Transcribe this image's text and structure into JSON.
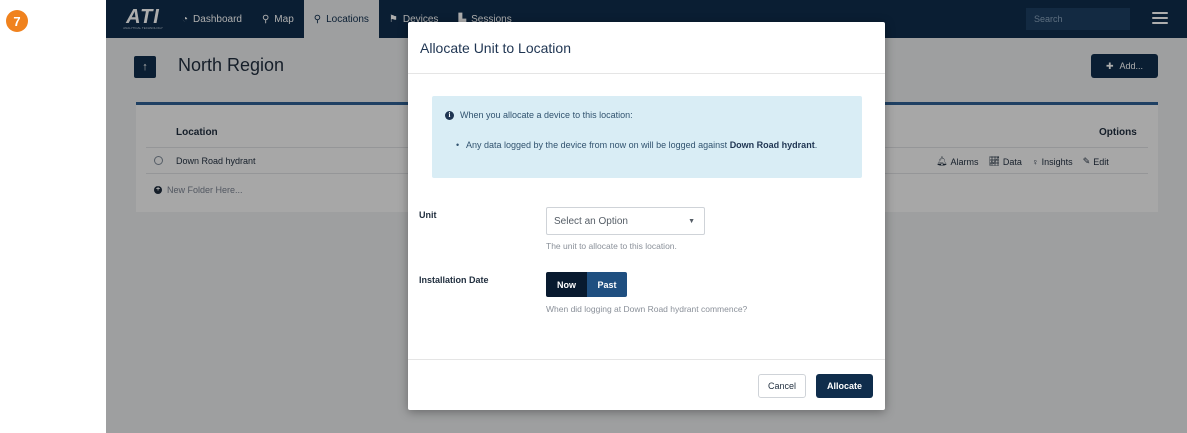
{
  "step_number": "7",
  "app": {
    "logo_text": "ATI",
    "logo_subtext": "ANALYTICAL TECHNOLOGY",
    "nav": [
      {
        "icon": "dashboard-icon",
        "glyph": "◔",
        "label": "Dashboard"
      },
      {
        "icon": "map-marker-icon",
        "glyph": "⚲",
        "label": "Map"
      },
      {
        "icon": "pin-icon",
        "glyph": "⚲",
        "label": "Locations"
      },
      {
        "icon": "device-icon",
        "glyph": "⚑",
        "label": "Devices"
      },
      {
        "icon": "sessions-icon",
        "glyph": "▙",
        "label": "Sessions"
      }
    ],
    "active_nav": "Locations",
    "search_placeholder": "Search",
    "page_title": "North Region",
    "add_label": "Add...",
    "table": {
      "header_location": "Location",
      "header_options": "Options",
      "rows": [
        {
          "location": "Down Road hydrant",
          "actions": [
            "Alarms",
            "Data",
            "Insights",
            "Edit"
          ]
        }
      ],
      "new_folder_label": "New Folder Here..."
    }
  },
  "modal": {
    "title": "Allocate Unit to Location",
    "alert_heading": "When you allocate a device to this location:",
    "alert_bullet_prefix": "Any data logged by the device from now on will be logged against",
    "alert_bullet_location": "Down Road hydrant",
    "alert_bullet_suffix": ".",
    "unit_label": "Unit",
    "unit_select_value": "Select an Option",
    "unit_help": "The unit to allocate to this location.",
    "installation_label": "Installation Date",
    "toggle_options": [
      "Now",
      "Past"
    ],
    "toggle_selected": "Now",
    "installation_help": "When did logging at Down Road hydrant commence?",
    "cancel_label": "Cancel",
    "allocate_label": "Allocate"
  },
  "colors": {
    "nav_bg": "#0f2d4c",
    "primary_button": "#0f2d4c",
    "step_badge": "#f0821e",
    "alert_bg": "#d9edf5"
  }
}
